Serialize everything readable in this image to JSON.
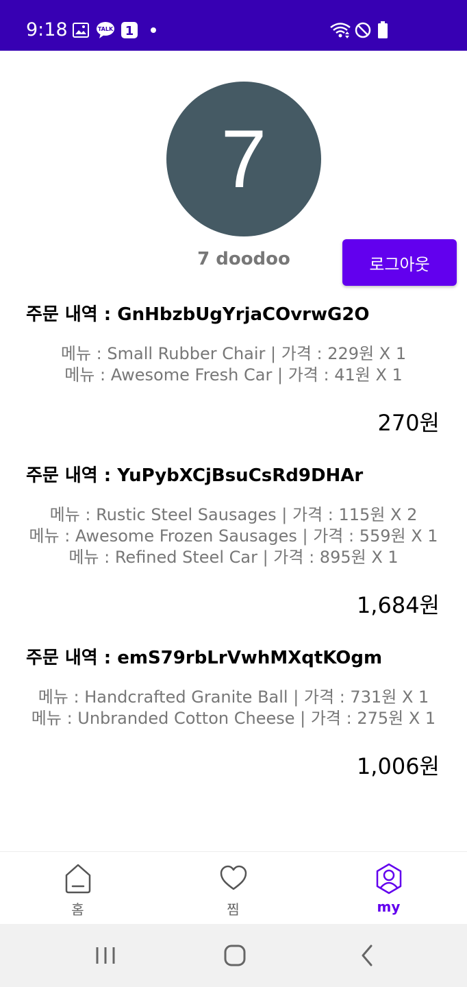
{
  "status_bar": {
    "time": "9:18",
    "background": "#3700b3",
    "notification_count": "1",
    "talk_badge": "TALK",
    "icons": [
      "gallery-icon",
      "kakaotalk-icon",
      "notification-count-icon",
      "wifi-icon",
      "do-not-disturb-icon",
      "battery-icon"
    ]
  },
  "profile": {
    "avatar_text": "7",
    "avatar_color": "#455a64",
    "name": "7 doodoo",
    "logout_label": "로그아웃",
    "accent": "#6200ee"
  },
  "orders": [
    {
      "heading": "주문 내역 : GnHbzbUgYrjaCOvrwG2O",
      "items": [
        "메뉴 : Small Rubber Chair | 가격 : 229원 X 1",
        "메뉴 : Awesome Fresh Car | 가격 : 41원 X 1"
      ],
      "total": "270원"
    },
    {
      "heading": "주문 내역 : YuPybXCjBsuCsRd9DHAr",
      "items": [
        "메뉴 : Rustic Steel Sausages | 가격 : 115원 X 2",
        "메뉴 : Awesome Frozen Sausages | 가격 : 559원 X 1",
        "메뉴 : Refined Steel Car | 가격 : 895원 X 1"
      ],
      "total": "1,684원"
    },
    {
      "heading": "주문 내역 : emS79rbLrVwhMXqtKOgm",
      "items": [
        "메뉴 : Handcrafted Granite Ball | 가격 : 731원 X 1",
        "메뉴 : Unbranded Cotton Cheese | 가격 : 275원 X 1"
      ],
      "total": "1,006원"
    }
  ],
  "bottom_nav": {
    "items": [
      {
        "label": "홈",
        "icon": "home-icon",
        "active": false
      },
      {
        "label": "찜",
        "icon": "heart-icon",
        "active": false
      },
      {
        "label": "my",
        "icon": "profile-icon",
        "active": true
      }
    ]
  },
  "system_bar": {
    "icons": [
      "recent-apps-icon",
      "home-circle-icon",
      "back-icon"
    ]
  }
}
